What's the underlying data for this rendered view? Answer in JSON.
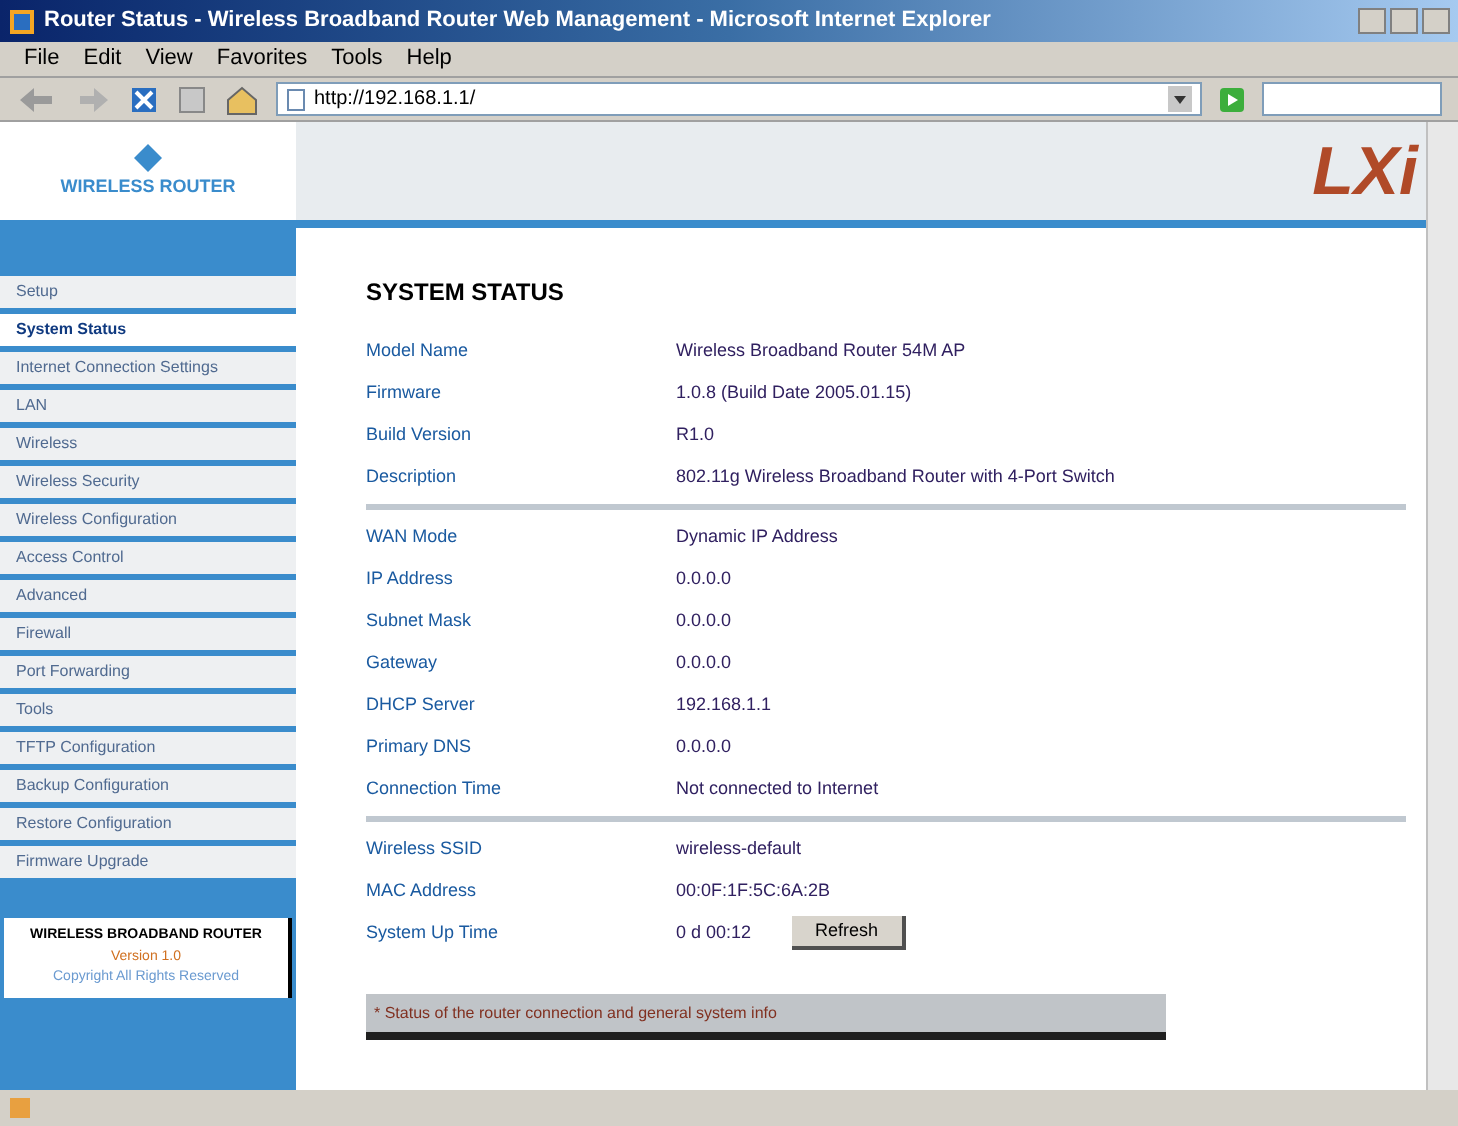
{
  "window": {
    "title": "Router Status - Wireless Broadband Router Web Management - Microsoft Internet Explorer"
  },
  "menu": [
    "File",
    "Edit",
    "View",
    "Favorites",
    "Tools",
    "Help"
  ],
  "address": {
    "value": "http://192.168.1.1/"
  },
  "brand": {
    "name": "WIRELESS ROUTER",
    "banner": "LXi"
  },
  "sidebar": [
    {
      "label": "Setup",
      "selected": false
    },
    {
      "label": "System Status",
      "selected": true
    },
    {
      "label": "Internet Connection Settings",
      "selected": false
    },
    {
      "label": "LAN",
      "selected": false
    },
    {
      "label": "Wireless",
      "selected": false
    },
    {
      "label": "Wireless Security",
      "selected": false
    },
    {
      "label": "Wireless Configuration",
      "selected": false
    },
    {
      "label": "Access Control",
      "selected": false
    },
    {
      "label": "Advanced",
      "selected": false
    },
    {
      "label": "Firewall",
      "selected": false
    },
    {
      "label": "Port Forwarding",
      "selected": false
    },
    {
      "label": "Tools",
      "selected": false
    },
    {
      "label": "TFTP Configuration",
      "selected": false
    },
    {
      "label": "Backup Configuration",
      "selected": false
    },
    {
      "label": "Restore Configuration",
      "selected": false
    },
    {
      "label": "Firmware Upgrade",
      "selected": false
    }
  ],
  "support": {
    "title": "WIRELESS BROADBAND ROUTER",
    "line1": "Version 1.0",
    "line2": "Copyright All Rights Reserved"
  },
  "heading": "SYSTEM STATUS",
  "sections": [
    [
      {
        "label": "Model Name",
        "value": "Wireless Broadband Router 54M AP"
      },
      {
        "label": "Firmware",
        "value": "1.0.8 (Build Date 2005.01.15)"
      },
      {
        "label": "Build Version",
        "value": "R1.0"
      },
      {
        "label": "Description",
        "value": "802.11g Wireless Broadband Router with 4-Port Switch"
      }
    ],
    [
      {
        "label": "WAN Mode",
        "value": "Dynamic IP Address"
      },
      {
        "label": "IP Address",
        "value": "0.0.0.0"
      },
      {
        "label": "Subnet Mask",
        "value": "0.0.0.0"
      },
      {
        "label": "Gateway",
        "value": "0.0.0.0"
      },
      {
        "label": "DHCP Server",
        "value": "192.168.1.1"
      },
      {
        "label": "Primary DNS",
        "value": "0.0.0.0"
      },
      {
        "label": "Connection Time",
        "value": "Not connected to Internet"
      }
    ],
    [
      {
        "label": "Wireless SSID",
        "value": "wireless-default"
      },
      {
        "label": "MAC Address",
        "value": "00:0F:1F:5C:6A:2B"
      },
      {
        "label": "System Up Time",
        "value": "0 d 00:12",
        "button": "Refresh"
      }
    ]
  ],
  "footer": "* Status of the router connection and general system info"
}
